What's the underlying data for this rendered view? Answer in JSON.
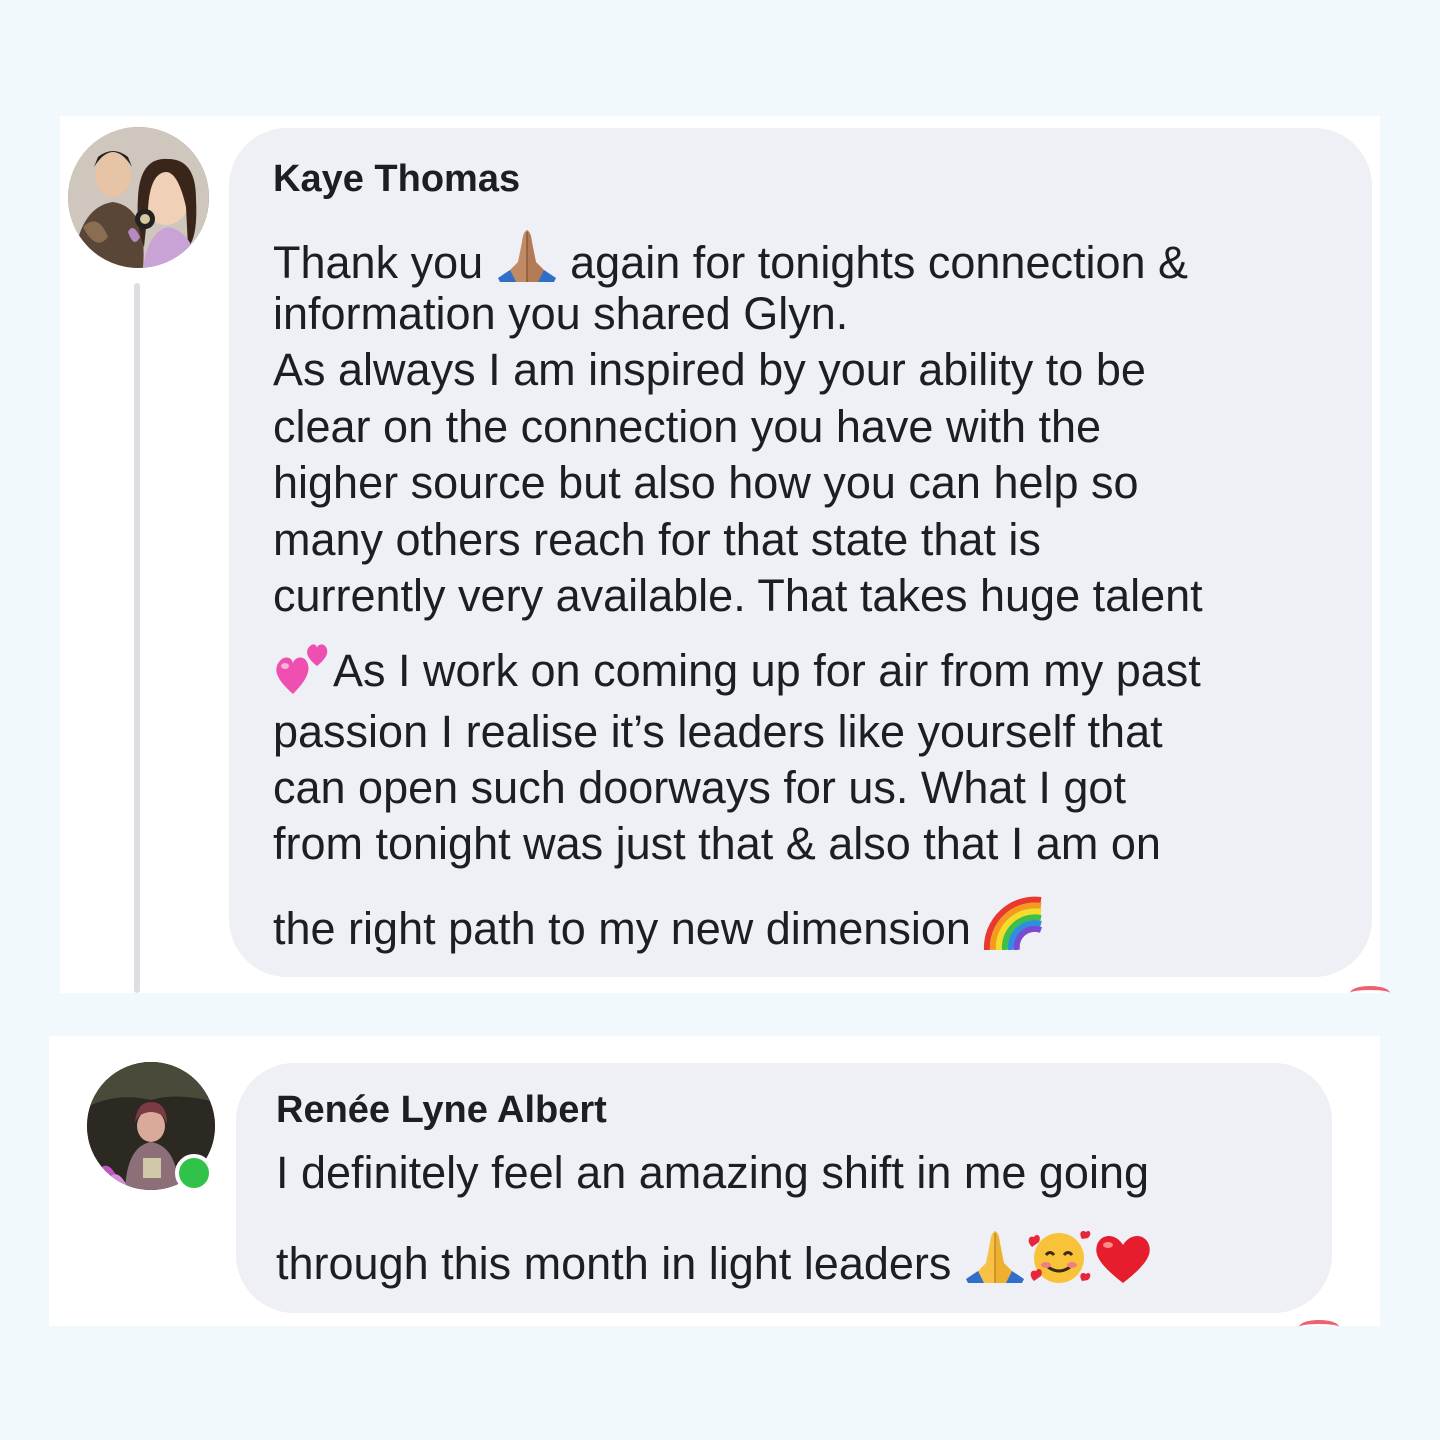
{
  "comments": [
    {
      "author": "Kaye Thomas",
      "avatar_icon": "avatar-photo-couple",
      "lines": [
        {
          "before": "Thank you ",
          "emoji": "folded-hands-medium-skin",
          "after": " again for tonights connection &"
        },
        {
          "before": "information you shared Glyn."
        },
        {
          "before": "As always I am inspired by your ability to be"
        },
        {
          "before": "clear on the connection you have with the"
        },
        {
          "before": "higher source but also how you can help so"
        },
        {
          "before": "many others reach for that state that is"
        },
        {
          "before": "currently very available. That takes huge talent"
        },
        {
          "emoji_lead": "two-hearts",
          "before": "As I work on coming up for air from my past"
        },
        {
          "before": "passion I realise it’s leaders like yourself that"
        },
        {
          "before": "can open such doorways for us. What I got"
        },
        {
          "before": "from tonight was just that & also that I am on"
        },
        {
          "before": "the right path to my new dimension ",
          "emoji": "rainbow"
        }
      ]
    },
    {
      "author": "Renée Lyne Albert",
      "avatar_icon": "avatar-photo-woman",
      "online": true,
      "lines": [
        {
          "before": "I definitely feel an amazing shift in me going"
        },
        {
          "before": "through this month in light leaders ",
          "emojis": [
            "folded-hands",
            "smiling-face-with-hearts",
            "red-heart"
          ]
        }
      ]
    }
  ],
  "colors": {
    "page_background": "#f1f9fc",
    "card_background": "#ffffff",
    "bubble_background": "#eef0f5",
    "text": "#1c1e21",
    "online_status": "#31c24a",
    "thread_line": "#dcdee2"
  }
}
